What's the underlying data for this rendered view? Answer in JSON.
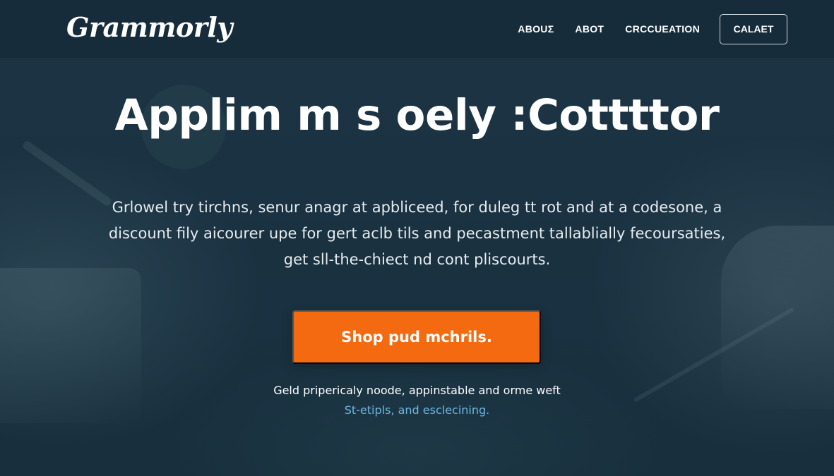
{
  "header": {
    "logo": "Grammorly",
    "nav": [
      {
        "label": "ABOUΣ"
      },
      {
        "label": "ABOT"
      },
      {
        "label": "CRCCUEATION"
      }
    ],
    "cta_button": "CALAET"
  },
  "hero": {
    "title": "Applim m s oely :Cottttor",
    "body_lines": [
      "Grlowel try tirchns, senur anagr at apbliceed, for duleg tt rot and at a codesone, a",
      "discount fily aicourer upe for gert aclb tils and pecastment tallablially fecoursaties,",
      "get sll-the-chiect nd cont pliscourts."
    ],
    "button": "Shop pud mchrils."
  },
  "footer_note": {
    "line": "Geld pripericaly noode, appinstable and orme weft",
    "link": "St-etipls, and esclecining."
  },
  "colors": {
    "background": "#1b3342",
    "header_bg": "#162c38",
    "accent_orange": "#f46a10",
    "link_blue": "#6fb8e0"
  }
}
